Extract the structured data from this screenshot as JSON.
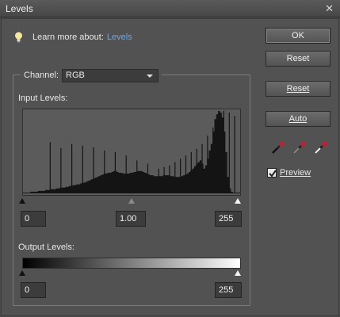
{
  "window": {
    "title": "Levels"
  },
  "learn": {
    "text": "Learn more about:",
    "link": "Levels"
  },
  "buttons": {
    "ok": "OK",
    "reset1": "Reset",
    "reset2": "Reset",
    "auto": "Auto"
  },
  "channel": {
    "label": "Channel:",
    "value": "RGB"
  },
  "input_levels": {
    "label": "Input Levels:",
    "black": "0",
    "gamma": "1.00",
    "white": "255"
  },
  "output_levels": {
    "label": "Output Levels:",
    "black": "0",
    "white": "255"
  },
  "preview": {
    "label": "Preview",
    "checked": true
  },
  "icons": [
    "lightbulb-icon",
    "close-icon",
    "chevron-down-icon",
    "black-eyedropper-icon",
    "gray-eyedropper-icon",
    "white-eyedropper-icon",
    "checkmark-icon"
  ],
  "colors": {
    "link": "#6fa6e8",
    "panel": "#525252",
    "field": "#3c3c3c"
  },
  "histogram": {
    "bins": [
      1,
      1,
      1,
      1,
      2,
      2,
      2,
      2,
      3,
      3,
      3,
      3,
      4,
      4,
      4,
      5,
      5,
      5,
      6,
      6,
      7,
      7,
      7,
      8,
      8,
      9,
      9,
      10,
      10,
      11,
      11,
      12,
      13,
      13,
      14,
      15,
      16,
      17,
      18,
      19,
      20,
      21,
      22,
      23,
      24,
      24,
      25,
      25,
      26,
      27,
      27,
      26,
      25,
      25,
      24,
      24,
      24,
      24,
      25,
      25,
      26,
      26,
      27,
      27,
      27,
      26,
      25,
      24,
      23,
      22,
      22,
      21,
      21,
      21,
      21,
      21,
      22,
      22,
      22,
      22,
      21,
      21,
      20,
      20,
      20,
      20,
      21,
      22,
      23,
      24,
      26,
      28,
      30,
      33,
      36,
      38,
      40,
      36,
      30,
      34,
      42,
      52,
      60,
      75,
      90,
      96,
      100,
      98,
      92,
      75,
      50,
      20,
      6,
      2,
      1,
      1,
      1,
      1
    ],
    "spikes": [
      [
        20,
        62
      ],
      [
        28,
        55
      ],
      [
        36,
        60
      ],
      [
        44,
        58
      ],
      [
        52,
        56
      ],
      [
        60,
        52
      ],
      [
        68,
        50
      ],
      [
        76,
        46
      ],
      [
        84,
        40
      ],
      [
        92,
        36
      ],
      [
        100,
        30
      ],
      [
        104,
        32
      ],
      [
        108,
        34
      ],
      [
        112,
        38
      ],
      [
        116,
        42
      ],
      [
        120,
        46
      ],
      [
        124,
        50
      ],
      [
        128,
        54
      ],
      [
        132,
        60
      ],
      [
        136,
        70
      ],
      [
        140,
        80
      ],
      [
        144,
        96
      ],
      [
        148,
        100
      ],
      [
        152,
        98
      ],
      [
        156,
        94
      ]
    ]
  }
}
